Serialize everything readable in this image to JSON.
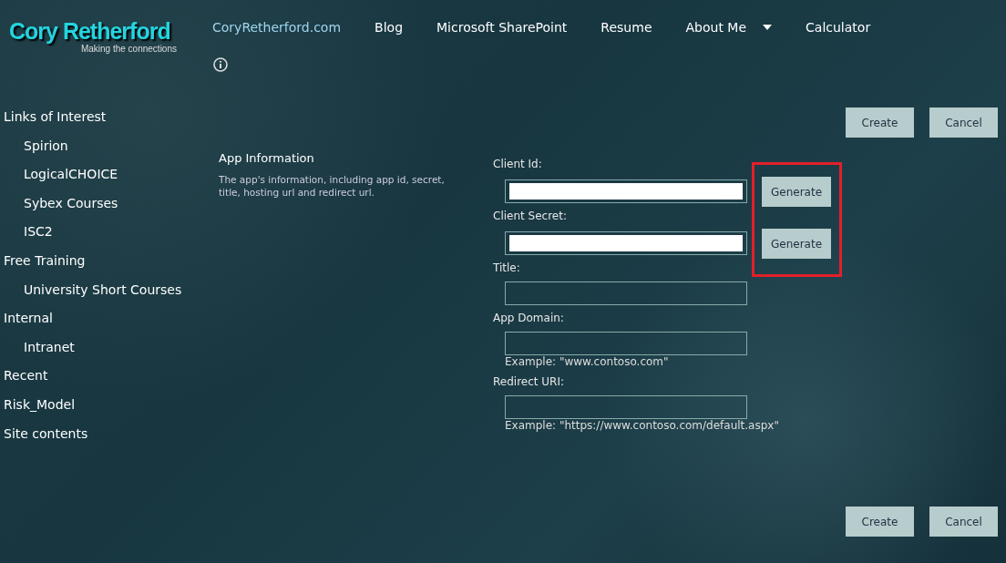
{
  "logo": {
    "title": "Cory Retherford",
    "tagline": "Making the connections"
  },
  "nav": [
    {
      "label": "CoryRetherford.com",
      "selected": true,
      "dropdown": false
    },
    {
      "label": "Blog",
      "selected": false,
      "dropdown": false
    },
    {
      "label": "Microsoft SharePoint",
      "selected": false,
      "dropdown": false
    },
    {
      "label": "Resume",
      "selected": false,
      "dropdown": false
    },
    {
      "label": "About Me",
      "selected": false,
      "dropdown": true
    },
    {
      "label": "Calculator",
      "selected": false,
      "dropdown": false
    }
  ],
  "sidebar": {
    "items": [
      {
        "label": "Links of Interest",
        "children": [
          {
            "label": "Spirion"
          },
          {
            "label": "LogicalCHOICE"
          },
          {
            "label": "Sybex Courses"
          },
          {
            "label": "ISC2"
          }
        ]
      },
      {
        "label": "Free Training",
        "children": [
          {
            "label": "University Short Courses"
          }
        ]
      },
      {
        "label": "Internal",
        "children": [
          {
            "label": "Intranet"
          }
        ]
      },
      {
        "label": "Recent"
      },
      {
        "label": "Risk_Model"
      },
      {
        "label": "Site contents"
      }
    ]
  },
  "top_buttons": [
    "Create",
    "Cancel"
  ],
  "section": {
    "title": "App Information",
    "description": "The app's information, including app id, secret, title, hosting url and redirect url."
  },
  "form": {
    "generate_highlighted": true,
    "fields": [
      {
        "label": "Client Id:",
        "redacted": true,
        "generate": "Generate"
      },
      {
        "label": "Client Secret:",
        "redacted": true,
        "generate": "Generate"
      },
      {
        "label": "Title:",
        "redacted": false
      },
      {
        "label": "App Domain:",
        "redacted": false,
        "example": "Example: \"www.contoso.com\""
      },
      {
        "label": "Redirect URI:",
        "redacted": false,
        "example": "Example: \"https://www.contoso.com/default.aspx\""
      }
    ]
  },
  "bottom_buttons": [
    "Create",
    "Cancel"
  ]
}
